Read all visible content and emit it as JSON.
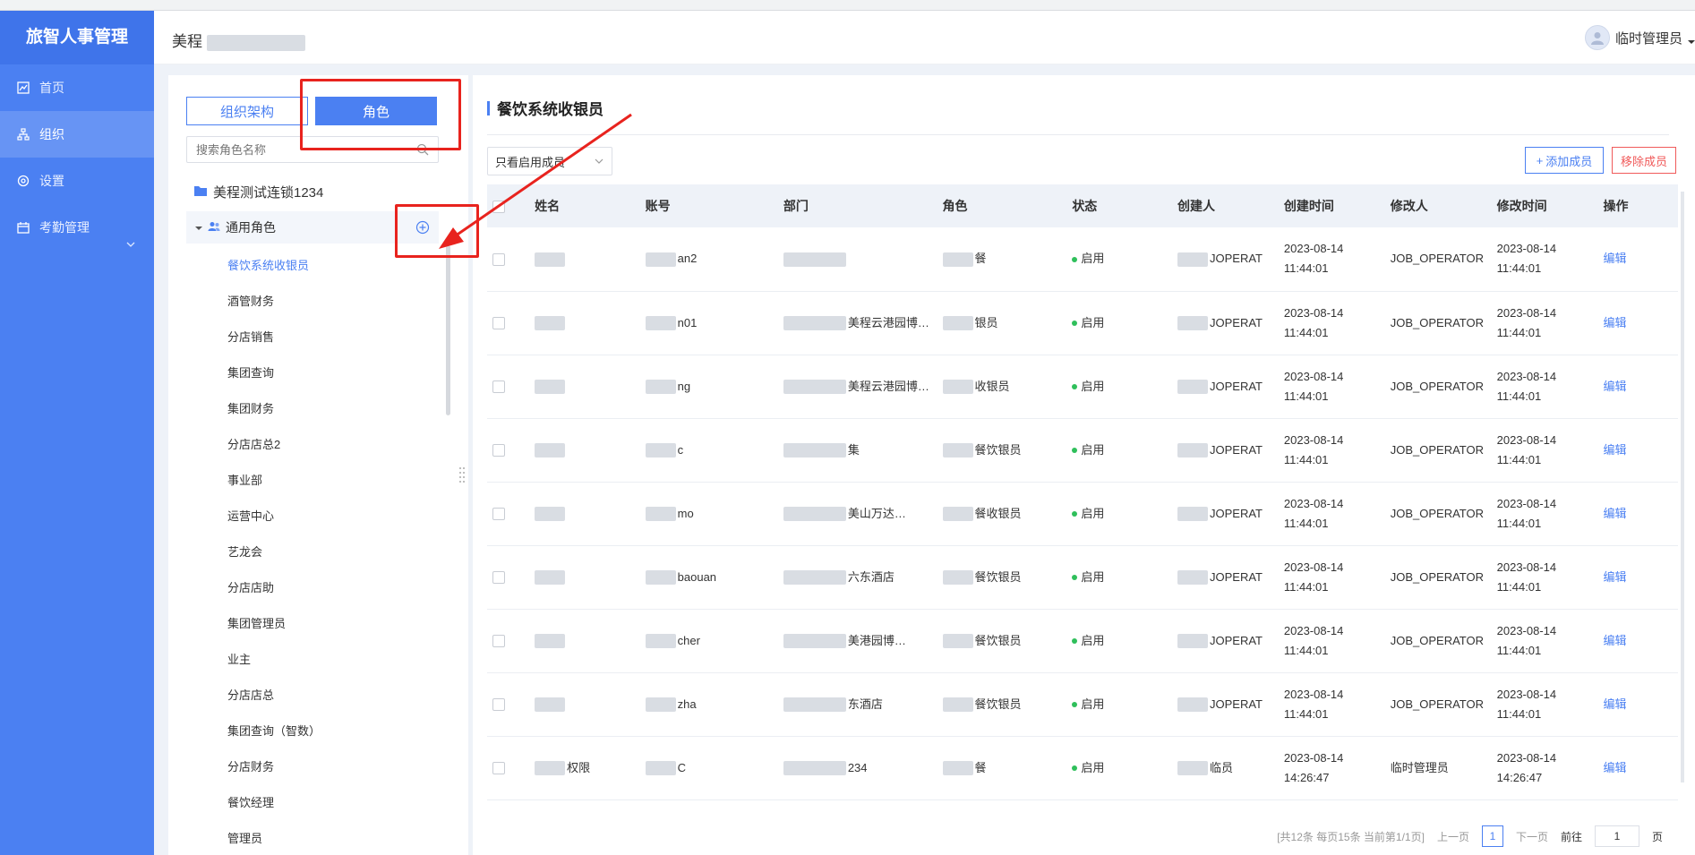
{
  "sidebar": {
    "brand": "旅智人事管理",
    "items": [
      {
        "label": "首页",
        "icon": "chart-icon"
      },
      {
        "label": "组织",
        "icon": "org-icon"
      },
      {
        "label": "设置",
        "icon": "gear-icon"
      },
      {
        "label": "考勤管理",
        "icon": "attendance-icon"
      }
    ]
  },
  "header": {
    "company": "美程",
    "user": "临时管理员"
  },
  "left": {
    "tab_org": "组织架构",
    "tab_role": "角色",
    "search_placeholder": "搜索角色名称",
    "root": "美程测试连锁1234",
    "group": "通用角色",
    "roles": [
      "餐饮系统收银员",
      "酒管财务",
      "分店销售",
      "集团查询",
      "集团财务",
      "分店店总2",
      "事业部",
      "运营中心",
      "艺龙会",
      "分店店助",
      "集团管理员",
      "业主",
      "分店店总",
      "集团查询（智数）",
      "分店财务",
      "餐饮经理",
      "管理员"
    ]
  },
  "right": {
    "title": "餐饮系统收银员",
    "filter": "只看启用成员",
    "add_btn": "添加成员",
    "remove_btn": "移除成员",
    "columns": [
      "姓名",
      "账号",
      "部门",
      "角色",
      "状态",
      "创建人",
      "创建时间",
      "修改人",
      "修改时间",
      "操作"
    ],
    "rows": [
      {
        "name": "",
        "account": "an2",
        "dept": "",
        "role": "餐",
        "status": "启用",
        "creator": "JOPERAT",
        "created": "2023-08-14 11:44:01",
        "modifier": "JOB_OPERATOR",
        "modified": "2023-08-14 11:44:01",
        "op": "编辑"
      },
      {
        "name": "",
        "account": "n01",
        "dept": "美程云港园博…",
        "role": "银员",
        "status": "启用",
        "creator": "JOPERAT",
        "created": "2023-08-14 11:44:01",
        "modifier": "JOB_OPERATOR",
        "modified": "2023-08-14 11:44:01",
        "op": "编辑"
      },
      {
        "name": "",
        "account": "ng",
        "dept": "美程云港园博…",
        "role": "收银员",
        "status": "启用",
        "creator": "JOPERAT",
        "created": "2023-08-14 11:44:01",
        "modifier": "JOB_OPERATOR",
        "modified": "2023-08-14 11:44:01",
        "op": "编辑"
      },
      {
        "name": "",
        "account": "c",
        "dept": "集",
        "role": "餐饮银员",
        "status": "启用",
        "creator": "JOPERAT",
        "created": "2023-08-14 11:44:01",
        "modifier": "JOB_OPERATOR",
        "modified": "2023-08-14 11:44:01",
        "op": "编辑"
      },
      {
        "name": "",
        "account": "mo",
        "dept": "美山万达…",
        "role": "餐收银员",
        "status": "启用",
        "creator": "JOPERAT",
        "created": "2023-08-14 11:44:01",
        "modifier": "JOB_OPERATOR",
        "modified": "2023-08-14 11:44:01",
        "op": "编辑"
      },
      {
        "name": "",
        "account": "baouan",
        "dept": "六东酒店",
        "role": "餐饮银员",
        "status": "启用",
        "creator": "JOPERAT",
        "created": "2023-08-14 11:44:01",
        "modifier": "JOB_OPERATOR",
        "modified": "2023-08-14 11:44:01",
        "op": "编辑"
      },
      {
        "name": "",
        "account": "cher",
        "dept": "美港园博…",
        "role": "餐饮银员",
        "status": "启用",
        "creator": "JOPERAT",
        "created": "2023-08-14 11:44:01",
        "modifier": "JOB_OPERATOR",
        "modified": "2023-08-14 11:44:01",
        "op": "编辑"
      },
      {
        "name": "",
        "account": "zha",
        "dept": "东酒店",
        "role": "餐饮银员",
        "status": "启用",
        "creator": "JOPERAT",
        "created": "2023-08-14 11:44:01",
        "modifier": "JOB_OPERATOR",
        "modified": "2023-08-14 11:44:01",
        "op": "编辑"
      },
      {
        "name": "权限",
        "account": "C",
        "dept": "234",
        "role": "餐",
        "status": "启用",
        "creator": "临员",
        "created": "2023-08-14 14:26:47",
        "modifier": "临时管理员",
        "modified": "2023-08-14 14:26:47",
        "op": "编辑"
      }
    ]
  },
  "pager": {
    "summary": "[共12条 每页15条 当前第1/1页]",
    "prev": "上一页",
    "current": "1",
    "next": "下一页",
    "goto_prefix": "前往",
    "goto_value": "1",
    "goto_suffix": "页"
  },
  "colors": {
    "primary": "#4b80f2",
    "sidebar": "#4b80f2",
    "danger": "#f05a5a",
    "annotation": "#e8231e"
  }
}
